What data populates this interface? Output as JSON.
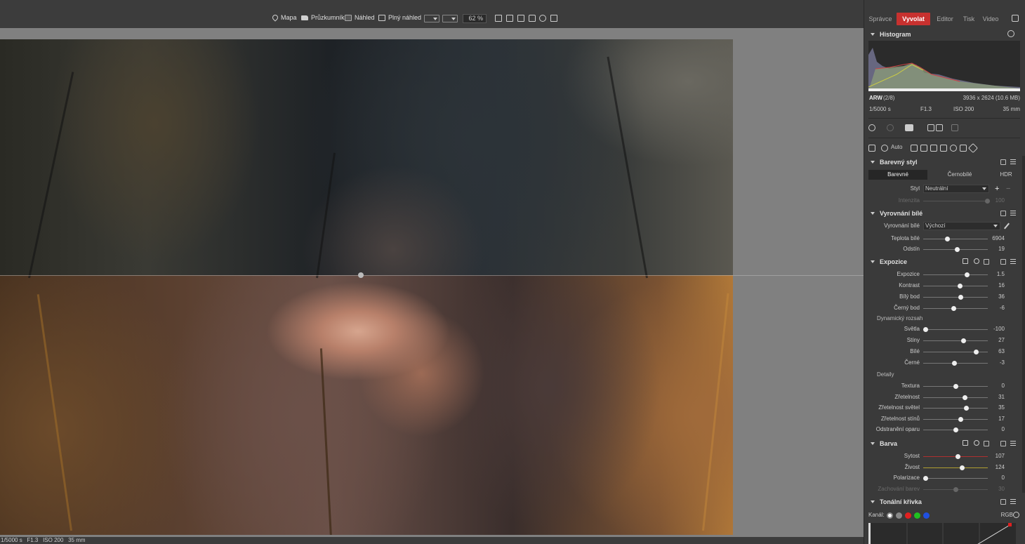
{
  "toolbar": {
    "map": "Mapa",
    "explorer": "Průzkumník",
    "preview": "Náhled",
    "full_preview": "Plný náhled",
    "zoom": "62 %"
  },
  "modules": [
    "Správce",
    "Vyvolat",
    "Editor",
    "Tisk",
    "Video"
  ],
  "active_module": "Vyvolat",
  "histogram": {
    "title": "Histogram",
    "format": "ARW",
    "index": "(2/8)",
    "dimensions": "3936 x 2624 (10.6 MB)",
    "shutter": "1/5000 s",
    "aperture": "F1.3",
    "iso": "ISO 200",
    "focal": "35 mm"
  },
  "tools": {
    "auto": "Auto"
  },
  "color_style": {
    "title": "Barevný styl",
    "tabs": [
      "Barevné",
      "Černobílé",
      "HDR"
    ],
    "style_label": "Styl",
    "style_value": "Neutrální",
    "strength_label": "Intenzita",
    "strength_value": "100"
  },
  "white_balance": {
    "title": "Vyrovnání bílé",
    "wb_label": "Vyrovnání bílé",
    "wb_value": "Výchozí",
    "params": [
      {
        "label": "Teplota bílé",
        "value": "6904",
        "pos": 0.37
      },
      {
        "label": "Odstín",
        "value": "19",
        "pos": 0.52
      }
    ]
  },
  "exposure": {
    "title": "Expozice",
    "params": [
      {
        "label": "Expozice",
        "value": "1.5",
        "pos": 0.67
      },
      {
        "label": "Kontrast",
        "value": "16",
        "pos": 0.57
      },
      {
        "label": "Bílý bod",
        "value": "36",
        "pos": 0.58
      },
      {
        "label": "Černý bod",
        "value": "-6",
        "pos": 0.47
      }
    ],
    "dynamic_label": "Dynamický rozsah",
    "dynamic": [
      {
        "label": "Světla",
        "value": "-100",
        "pos": 0.03
      },
      {
        "label": "Stíny",
        "value": "27",
        "pos": 0.62
      },
      {
        "label": "Bílé",
        "value": "63",
        "pos": 0.81
      },
      {
        "label": "Černé",
        "value": "-3",
        "pos": 0.48
      }
    ],
    "details_label": "Detaily",
    "details": [
      {
        "label": "Textura",
        "value": "0",
        "pos": 0.5
      },
      {
        "label": "Zřetelnost",
        "value": "31",
        "pos": 0.64
      },
      {
        "label": "Zřetelnost světel",
        "value": "35",
        "pos": 0.66
      },
      {
        "label": "Zřetelnost stínů",
        "value": "17",
        "pos": 0.58
      },
      {
        "label": "Odstranění oparu",
        "value": "0",
        "pos": 0.5
      }
    ]
  },
  "color": {
    "title": "Barva",
    "params": [
      {
        "label": "Sytost",
        "value": "107",
        "pos": 0.53,
        "color": "#b03030"
      },
      {
        "label": "Živost",
        "value": "124",
        "pos": 0.6,
        "color": "#b0a030"
      },
      {
        "label": "Polarizace",
        "value": "0",
        "pos": 0.03,
        "color": "#777777"
      },
      {
        "label": "Zachování barev",
        "value": "30",
        "pos": 0.5,
        "color": "#555555",
        "dim": true
      }
    ]
  },
  "tone_curve": {
    "title": "Tonální křivka",
    "channel_label": "Kanál:",
    "channel_value": "RGB",
    "channels": [
      "#ffffff",
      "#888888",
      "#e02020",
      "#20c020",
      "#2050e0"
    ]
  },
  "status": {
    "shutter": "1/5000 s",
    "aperture": "F1.3",
    "iso": "ISO 200",
    "focal": "35 mm"
  },
  "colors": {
    "accent": "#c8312f",
    "panel": "#3a3a3a",
    "canvas": "#808080"
  }
}
